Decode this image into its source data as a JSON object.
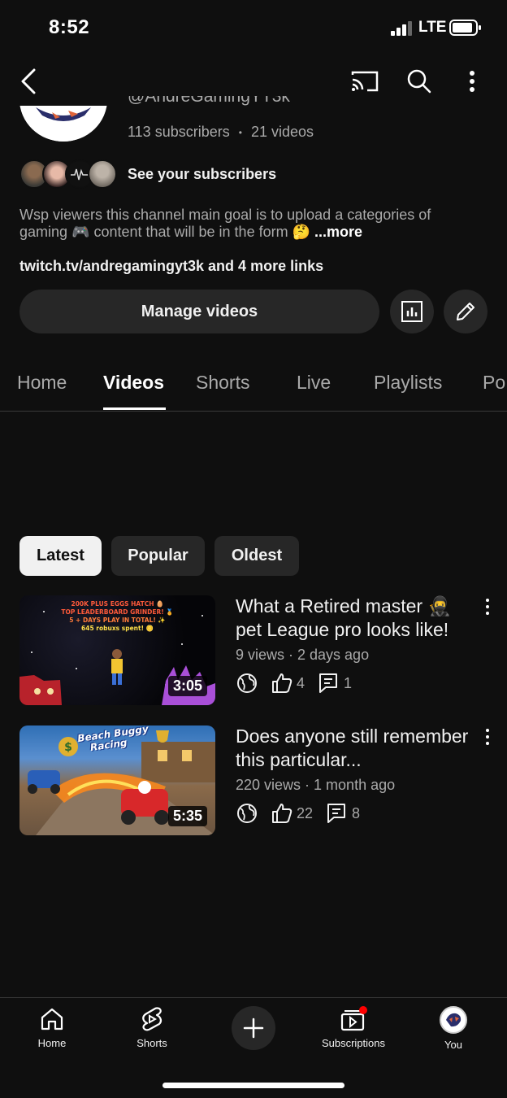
{
  "status_bar": {
    "time": "8:52",
    "network": "LTE"
  },
  "channel": {
    "handle": "@AndreGamingYT3k",
    "subscribers": "113 subscribers",
    "separator": "•",
    "video_count": "21 videos",
    "see_subscribers": "See your subscribers",
    "description": "Wsp viewers this channel main goal is to upload a categories of gaming 🎮 content that will be in the form 🤔",
    "more": "...more",
    "links": "twitch.tv/andregamingyt3k and 4 more links",
    "manage_videos": "Manage videos"
  },
  "tabs": [
    {
      "label": "Home"
    },
    {
      "label": "Videos"
    },
    {
      "label": "Shorts"
    },
    {
      "label": "Live"
    },
    {
      "label": "Playlists"
    },
    {
      "label": "Po"
    }
  ],
  "filters": [
    {
      "label": "Latest"
    },
    {
      "label": "Popular"
    },
    {
      "label": "Oldest"
    }
  ],
  "videos": [
    {
      "title": "What a Retired master 🥷 pet League pro looks like!",
      "meta": "9 views · 2 days ago",
      "likes": "4",
      "comments": "1",
      "duration": "3:05",
      "thumb_lines": [
        "200K PLUS EGGS HATCH 🥚",
        "TOP LEADERBOARD GRINDER! 🏅",
        "5 + DAYS PLAY IN TOTAL! ✨",
        "645 robuxs spent! 🪙"
      ]
    },
    {
      "title": "Does anyone still remember this particular...",
      "meta": "220 views · 1 month ago",
      "likes": "22",
      "comments": "8",
      "duration": "5:35",
      "thumb_lines": [
        "Beach Buggy",
        "Racing"
      ]
    }
  ],
  "bottom_nav": {
    "home": "Home",
    "shorts": "Shorts",
    "subscriptions": "Subscriptions",
    "you": "You"
  },
  "colors": {
    "background": "#0f0f0f",
    "chip": "#272727",
    "secondary_text": "#aaaaaa",
    "notification_dot": "#ff0000"
  }
}
